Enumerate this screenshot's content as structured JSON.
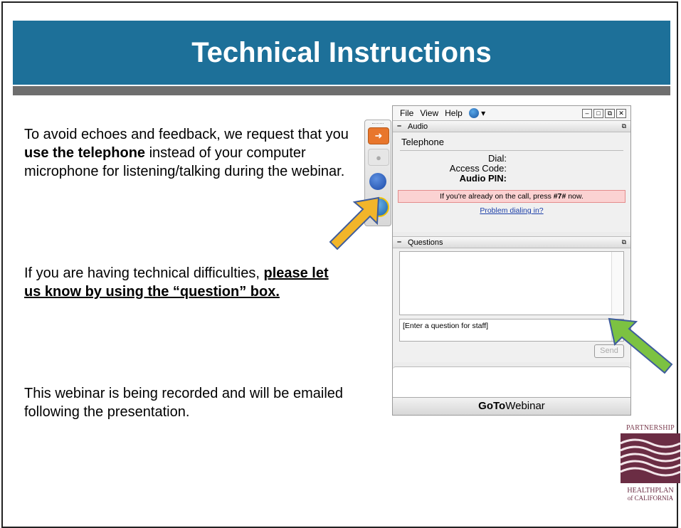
{
  "slide": {
    "title": "Technical Instructions",
    "para1": {
      "text_a": "To avoid echoes and feedback, we request that you ",
      "bold": "use the telephone",
      "text_b": " instead of your computer microphone for listening/talking during the webinar."
    },
    "para2": {
      "text_a": "If you are having technical difficulties, ",
      "bold_underline": "please let us know by using the “question” box."
    },
    "para3": "This webinar is being recorded and will be emailed following the presentation."
  },
  "gtw_panel": {
    "menu": [
      "File",
      "View",
      "Help"
    ],
    "audio_section": "Audio",
    "telephone_label": "Telephone",
    "dial_label": "Dial:",
    "access_code_label": "Access Code:",
    "audio_pin_label": "Audio PIN:",
    "notice_a": "If you're already on the call, press ",
    "notice_key": "#7#",
    "notice_b": " now.",
    "problem_link": "Problem dialing in?",
    "questions_section": "Questions",
    "question_placeholder": "[Enter a question for staff]",
    "send_label": "Send",
    "brand_bold": "GoTo",
    "brand_rest": "Webinar"
  },
  "logo": {
    "top_text": "PARTNERSHIP",
    "bottom_text": "HEALTHPLAN",
    "bottom_sub": "of CALIFORNIA"
  },
  "colors": {
    "title_bar": "#1d7099",
    "rule": "#6e6e6e",
    "arrow_yellow": "#f2b52a",
    "arrow_green": "#7cc242",
    "logo_maroon": "#6b2d44"
  }
}
